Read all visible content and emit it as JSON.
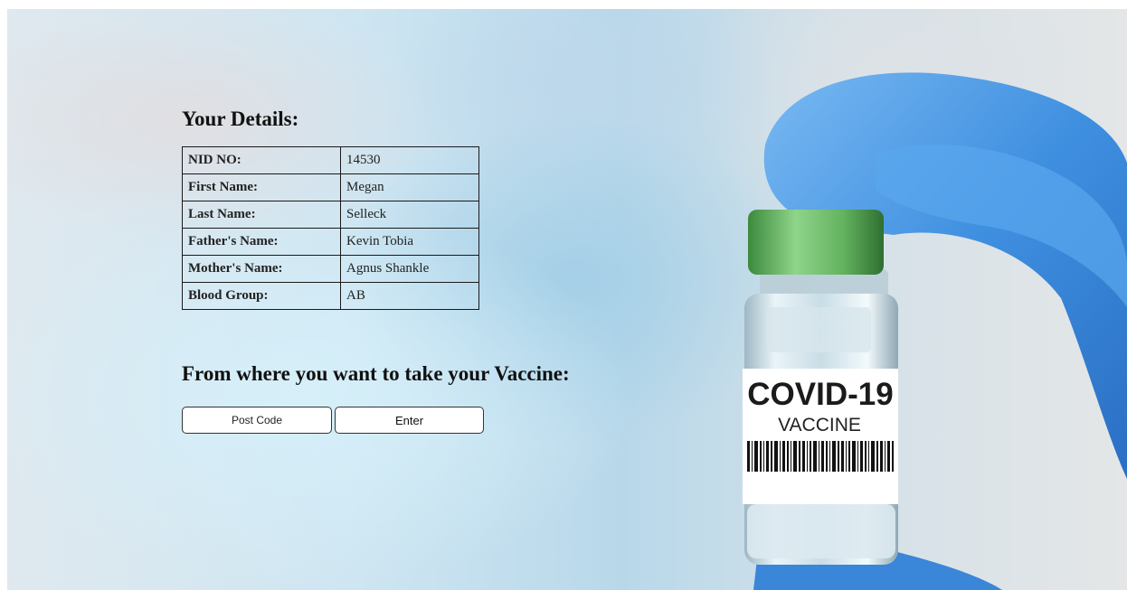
{
  "details": {
    "title": "Your Details:",
    "rows": [
      {
        "label": "NID NO:",
        "value": "14530"
      },
      {
        "label": "First Name:",
        "value": "Megan"
      },
      {
        "label": "Last Name:",
        "value": "Selleck"
      },
      {
        "label": "Father's Name:",
        "value": "Kevin Tobia"
      },
      {
        "label": "Mother's Name:",
        "value": "Agnus Shankle"
      },
      {
        "label": "Blood Group:",
        "value": "AB"
      }
    ]
  },
  "vaccine": {
    "title": "From where you want to take your Vaccine:",
    "postcode_placeholder": "Post Code",
    "enter_label": "Enter"
  },
  "vial": {
    "label_line1": "COVID-19",
    "label_line2": "VACCINE",
    "icon": "vaccine-vial-icon"
  },
  "colors": {
    "glove": "#3f8fe0",
    "cap": "#6cbf6a",
    "text": "#111111"
  }
}
